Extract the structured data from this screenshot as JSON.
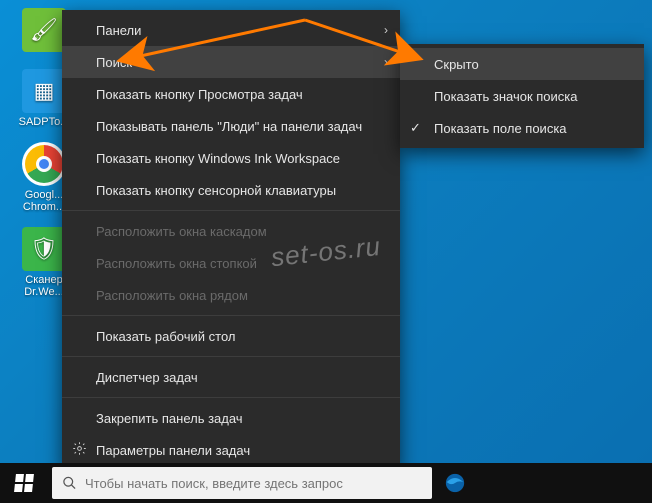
{
  "desktop_icons": [
    {
      "name": "paint-icon",
      "label": ""
    },
    {
      "name": "sadp-icon",
      "label": "SADPTo..."
    },
    {
      "name": "chrome-icon",
      "label": "Googl..."
    },
    {
      "name": "chrome-label2",
      "label": "Chrom..."
    },
    {
      "name": "scanner-icon",
      "label": "Сканер"
    },
    {
      "name": "scanner-label2",
      "label": "Dr.We..."
    }
  ],
  "ctx_main": [
    {
      "label": "Панели",
      "submenu": true
    },
    {
      "label": "Поиск",
      "submenu": true,
      "hover": true
    },
    {
      "label": "Показать кнопку Просмотра задач"
    },
    {
      "label": "Показывать панель \"Люди\" на панели задач"
    },
    {
      "label": "Показать кнопку Windows Ink Workspace"
    },
    {
      "label": "Показать кнопку сенсорной клавиатуры"
    },
    {
      "sep": true
    },
    {
      "label": "Расположить окна каскадом",
      "disabled": true
    },
    {
      "label": "Расположить окна стопкой",
      "disabled": true
    },
    {
      "label": "Расположить окна рядом",
      "disabled": true
    },
    {
      "sep": true
    },
    {
      "label": "Показать рабочий стол"
    },
    {
      "sep": true
    },
    {
      "label": "Диспетчер задач"
    },
    {
      "sep": true
    },
    {
      "label": "Закрепить панель задач"
    },
    {
      "label": "Параметры панели задач",
      "gear": true
    }
  ],
  "ctx_sub": [
    {
      "label": "Скрыто",
      "hover": true
    },
    {
      "label": "Показать значок поиска"
    },
    {
      "label": "Показать поле поиска",
      "checked": true
    }
  ],
  "taskbar": {
    "search_placeholder": "Чтобы начать поиск, введите здесь запрос"
  },
  "watermark": "set-os.ru"
}
